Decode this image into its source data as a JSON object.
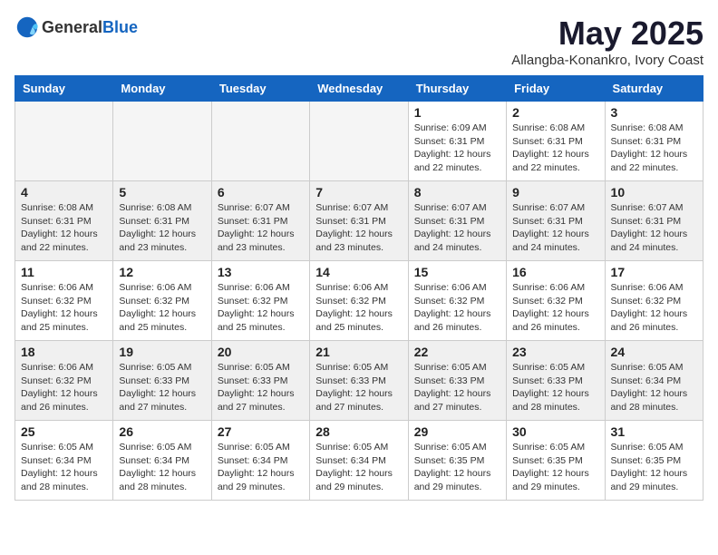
{
  "header": {
    "logo_general": "General",
    "logo_blue": "Blue",
    "month_title": "May 2025",
    "location": "Allangba-Konankro, Ivory Coast"
  },
  "days_of_week": [
    "Sunday",
    "Monday",
    "Tuesday",
    "Wednesday",
    "Thursday",
    "Friday",
    "Saturday"
  ],
  "weeks": [
    [
      {
        "day": "",
        "empty": true
      },
      {
        "day": "",
        "empty": true
      },
      {
        "day": "",
        "empty": true
      },
      {
        "day": "",
        "empty": true
      },
      {
        "day": "1",
        "sunrise": "6:09 AM",
        "sunset": "6:31 PM",
        "daylight": "12 hours and 22 minutes."
      },
      {
        "day": "2",
        "sunrise": "6:08 AM",
        "sunset": "6:31 PM",
        "daylight": "12 hours and 22 minutes."
      },
      {
        "day": "3",
        "sunrise": "6:08 AM",
        "sunset": "6:31 PM",
        "daylight": "12 hours and 22 minutes."
      }
    ],
    [
      {
        "day": "4",
        "sunrise": "6:08 AM",
        "sunset": "6:31 PM",
        "daylight": "12 hours and 22 minutes."
      },
      {
        "day": "5",
        "sunrise": "6:08 AM",
        "sunset": "6:31 PM",
        "daylight": "12 hours and 23 minutes."
      },
      {
        "day": "6",
        "sunrise": "6:07 AM",
        "sunset": "6:31 PM",
        "daylight": "12 hours and 23 minutes."
      },
      {
        "day": "7",
        "sunrise": "6:07 AM",
        "sunset": "6:31 PM",
        "daylight": "12 hours and 23 minutes."
      },
      {
        "day": "8",
        "sunrise": "6:07 AM",
        "sunset": "6:31 PM",
        "daylight": "12 hours and 24 minutes."
      },
      {
        "day": "9",
        "sunrise": "6:07 AM",
        "sunset": "6:31 PM",
        "daylight": "12 hours and 24 minutes."
      },
      {
        "day": "10",
        "sunrise": "6:07 AM",
        "sunset": "6:31 PM",
        "daylight": "12 hours and 24 minutes."
      }
    ],
    [
      {
        "day": "11",
        "sunrise": "6:06 AM",
        "sunset": "6:32 PM",
        "daylight": "12 hours and 25 minutes."
      },
      {
        "day": "12",
        "sunrise": "6:06 AM",
        "sunset": "6:32 PM",
        "daylight": "12 hours and 25 minutes."
      },
      {
        "day": "13",
        "sunrise": "6:06 AM",
        "sunset": "6:32 PM",
        "daylight": "12 hours and 25 minutes."
      },
      {
        "day": "14",
        "sunrise": "6:06 AM",
        "sunset": "6:32 PM",
        "daylight": "12 hours and 25 minutes."
      },
      {
        "day": "15",
        "sunrise": "6:06 AM",
        "sunset": "6:32 PM",
        "daylight": "12 hours and 26 minutes."
      },
      {
        "day": "16",
        "sunrise": "6:06 AM",
        "sunset": "6:32 PM",
        "daylight": "12 hours and 26 minutes."
      },
      {
        "day": "17",
        "sunrise": "6:06 AM",
        "sunset": "6:32 PM",
        "daylight": "12 hours and 26 minutes."
      }
    ],
    [
      {
        "day": "18",
        "sunrise": "6:06 AM",
        "sunset": "6:32 PM",
        "daylight": "12 hours and 26 minutes."
      },
      {
        "day": "19",
        "sunrise": "6:05 AM",
        "sunset": "6:33 PM",
        "daylight": "12 hours and 27 minutes."
      },
      {
        "day": "20",
        "sunrise": "6:05 AM",
        "sunset": "6:33 PM",
        "daylight": "12 hours and 27 minutes."
      },
      {
        "day": "21",
        "sunrise": "6:05 AM",
        "sunset": "6:33 PM",
        "daylight": "12 hours and 27 minutes."
      },
      {
        "day": "22",
        "sunrise": "6:05 AM",
        "sunset": "6:33 PM",
        "daylight": "12 hours and 27 minutes."
      },
      {
        "day": "23",
        "sunrise": "6:05 AM",
        "sunset": "6:33 PM",
        "daylight": "12 hours and 28 minutes."
      },
      {
        "day": "24",
        "sunrise": "6:05 AM",
        "sunset": "6:34 PM",
        "daylight": "12 hours and 28 minutes."
      }
    ],
    [
      {
        "day": "25",
        "sunrise": "6:05 AM",
        "sunset": "6:34 PM",
        "daylight": "12 hours and 28 minutes."
      },
      {
        "day": "26",
        "sunrise": "6:05 AM",
        "sunset": "6:34 PM",
        "daylight": "12 hours and 28 minutes."
      },
      {
        "day": "27",
        "sunrise": "6:05 AM",
        "sunset": "6:34 PM",
        "daylight": "12 hours and 29 minutes."
      },
      {
        "day": "28",
        "sunrise": "6:05 AM",
        "sunset": "6:34 PM",
        "daylight": "12 hours and 29 minutes."
      },
      {
        "day": "29",
        "sunrise": "6:05 AM",
        "sunset": "6:35 PM",
        "daylight": "12 hours and 29 minutes."
      },
      {
        "day": "30",
        "sunrise": "6:05 AM",
        "sunset": "6:35 PM",
        "daylight": "12 hours and 29 minutes."
      },
      {
        "day": "31",
        "sunrise": "6:05 AM",
        "sunset": "6:35 PM",
        "daylight": "12 hours and 29 minutes."
      }
    ]
  ]
}
